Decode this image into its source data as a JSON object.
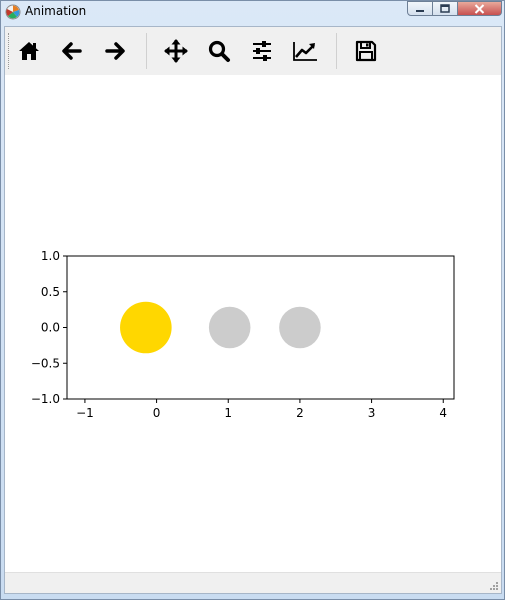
{
  "window": {
    "title": "Animation",
    "app_icon": "matplotlib-icon",
    "controls": [
      "minimize-icon",
      "maximize-icon",
      "close-icon"
    ]
  },
  "toolbar": {
    "buttons": [
      {
        "name": "home-button",
        "icon": "home-icon"
      },
      {
        "name": "back-button",
        "icon": "arrow-left-icon"
      },
      {
        "name": "forward-button",
        "icon": "arrow-right-icon"
      },
      {
        "name": "pan-button",
        "icon": "move-icon"
      },
      {
        "name": "zoom-button",
        "icon": "magnifier-icon"
      },
      {
        "name": "configure-subplots-button",
        "icon": "sliders-icon"
      },
      {
        "name": "edit-axis-button",
        "icon": "line-chart-icon"
      },
      {
        "name": "save-button",
        "icon": "floppy-disk-icon"
      }
    ]
  },
  "chart_data": {
    "type": "scatter",
    "xlim": [
      -1.25,
      4.15
    ],
    "ylim": [
      -1.0,
      1.0
    ],
    "xticks": [
      -1,
      0,
      1,
      2,
      3,
      4
    ],
    "xtick_labels": [
      "−1",
      "0",
      "1",
      "2",
      "3",
      "4"
    ],
    "yticks": [
      1.0,
      0.5,
      0.0,
      -0.5,
      -1.0
    ],
    "ytick_labels": [
      "1.0",
      "0.5",
      "0.0",
      "−0.5",
      "−1.0"
    ],
    "grid": false,
    "points": [
      {
        "x": -0.15,
        "y": 0.0,
        "radius": 0.36,
        "color": "#ffd700"
      },
      {
        "x": 1.02,
        "y": 0.0,
        "radius": 0.29,
        "color": "#cccccc"
      },
      {
        "x": 2.0,
        "y": 0.0,
        "radius": 0.29,
        "color": "#cccccc"
      }
    ]
  }
}
